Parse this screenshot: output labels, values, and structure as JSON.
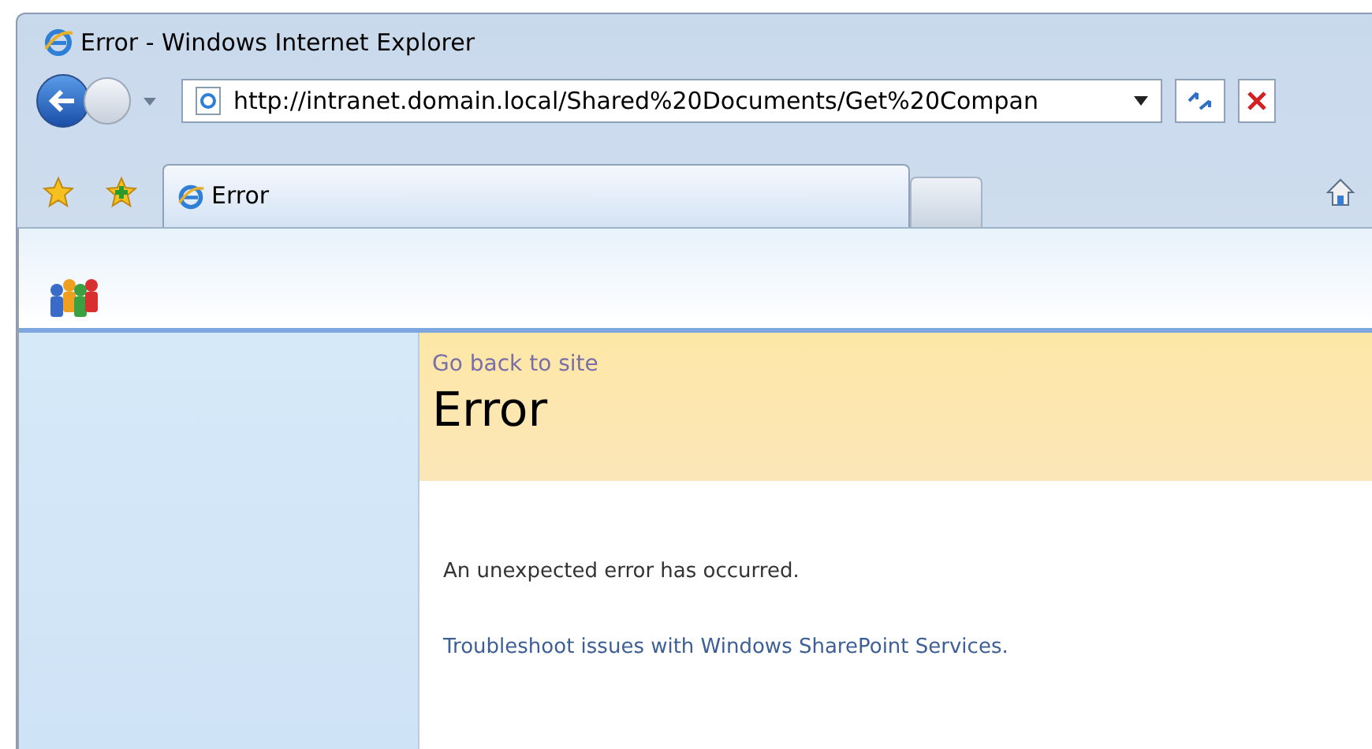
{
  "window": {
    "title": "Error - Windows Internet Explorer"
  },
  "address_bar": {
    "value": "http://intranet.domain.local/Shared%20Documents/Get%20Compan"
  },
  "tabs": [
    {
      "label": "Error",
      "selected": true
    },
    {
      "selected": false
    }
  ],
  "page": {
    "back_link": "Go back to site",
    "heading": "Error",
    "message": "An unexpected error has occurred.",
    "help_link": "Troubleshoot issues with Windows SharePoint Services."
  }
}
